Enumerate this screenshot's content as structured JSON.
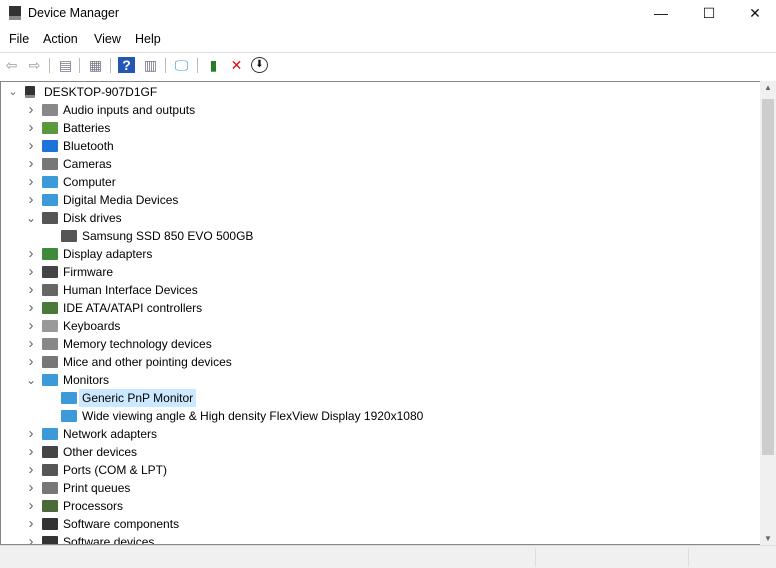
{
  "window": {
    "title": "Device Manager",
    "minimize": "—",
    "maximize": "☐",
    "close": "✕"
  },
  "menu": [
    "File",
    "Action",
    "View",
    "Help"
  ],
  "toolbar": [
    {
      "icon": "back-arrow-icon",
      "glyph": "⇦"
    },
    {
      "icon": "forward-arrow-icon",
      "glyph": "⇨"
    },
    {
      "icon": "show-hide-console-tree-icon",
      "glyph": "▤"
    },
    {
      "icon": "properties-icon",
      "glyph": "▦"
    },
    {
      "icon": "help-icon",
      "glyph": "?"
    },
    {
      "icon": "action-pane-icon",
      "glyph": "▥"
    },
    {
      "icon": "scan-hardware-icon",
      "glyph": "🖵"
    },
    {
      "icon": "update-driver-icon",
      "glyph": "▮"
    },
    {
      "icon": "uninstall-device-icon",
      "glyph": "✕"
    },
    {
      "icon": "disable-device-icon",
      "glyph": "⬇"
    }
  ],
  "tree": {
    "root": "DESKTOP-907D1GF",
    "items": [
      {
        "label": "Audio inputs and outputs",
        "icon": "speaker-icon",
        "color": "#888",
        "level": 1,
        "expanded": false
      },
      {
        "label": "Batteries",
        "icon": "battery-icon",
        "color": "#5a9a3c",
        "level": 1,
        "expanded": false
      },
      {
        "label": "Bluetooth",
        "icon": "bluetooth-icon",
        "color": "#1e73d8",
        "level": 1,
        "expanded": false
      },
      {
        "label": "Cameras",
        "icon": "camera-icon",
        "color": "#777",
        "level": 1,
        "expanded": false
      },
      {
        "label": "Computer",
        "icon": "computer-icon",
        "color": "#3d9ad8",
        "level": 1,
        "expanded": false
      },
      {
        "label": "Digital Media Devices",
        "icon": "media-device-icon",
        "color": "#3d9ad8",
        "level": 1,
        "expanded": false
      },
      {
        "label": "Disk drives",
        "icon": "disk-drive-icon",
        "color": "#555",
        "level": 1,
        "expanded": true
      },
      {
        "label": "Samsung SSD 850 EVO 500GB",
        "icon": "disk-drive-icon",
        "color": "#555",
        "level": 2
      },
      {
        "label": "Display adapters",
        "icon": "display-adapter-icon",
        "color": "#3d8a3d",
        "level": 1,
        "expanded": false
      },
      {
        "label": "Firmware",
        "icon": "firmware-icon",
        "color": "#444",
        "level": 1,
        "expanded": false
      },
      {
        "label": "Human Interface Devices",
        "icon": "hid-icon",
        "color": "#666",
        "level": 1,
        "expanded": false
      },
      {
        "label": "IDE ATA/ATAPI controllers",
        "icon": "ide-controller-icon",
        "color": "#4a7a3a",
        "level": 1,
        "expanded": false
      },
      {
        "label": "Keyboards",
        "icon": "keyboard-icon",
        "color": "#999",
        "level": 1,
        "expanded": false
      },
      {
        "label": "Memory technology devices",
        "icon": "memory-icon",
        "color": "#888",
        "level": 1,
        "expanded": false
      },
      {
        "label": "Mice and other pointing devices",
        "icon": "mouse-icon",
        "color": "#777",
        "level": 1,
        "expanded": false
      },
      {
        "label": "Monitors",
        "icon": "monitor-icon",
        "color": "#3d9ad8",
        "level": 1,
        "expanded": true
      },
      {
        "label": "Generic PnP Monitor",
        "icon": "monitor-icon",
        "color": "#3d9ad8",
        "level": 2,
        "selected": true
      },
      {
        "label": "Wide viewing angle & High density FlexView Display 1920x1080",
        "icon": "monitor-icon",
        "color": "#3d9ad8",
        "level": 2
      },
      {
        "label": "Network adapters",
        "icon": "network-adapter-icon",
        "color": "#3d9ad8",
        "level": 1,
        "expanded": false
      },
      {
        "label": "Other devices",
        "icon": "unknown-device-icon",
        "color": "#444",
        "level": 1,
        "expanded": false
      },
      {
        "label": "Ports (COM & LPT)",
        "icon": "port-icon",
        "color": "#555",
        "level": 1,
        "expanded": false
      },
      {
        "label": "Print queues",
        "icon": "printer-icon",
        "color": "#777",
        "level": 1,
        "expanded": false
      },
      {
        "label": "Processors",
        "icon": "processor-icon",
        "color": "#4a6a3a",
        "level": 1,
        "expanded": false
      },
      {
        "label": "Software components",
        "icon": "software-component-icon",
        "color": "#333",
        "level": 1,
        "expanded": false
      },
      {
        "label": "Software devices",
        "icon": "software-device-icon",
        "color": "#333",
        "level": 1,
        "expanded": false
      }
    ]
  }
}
